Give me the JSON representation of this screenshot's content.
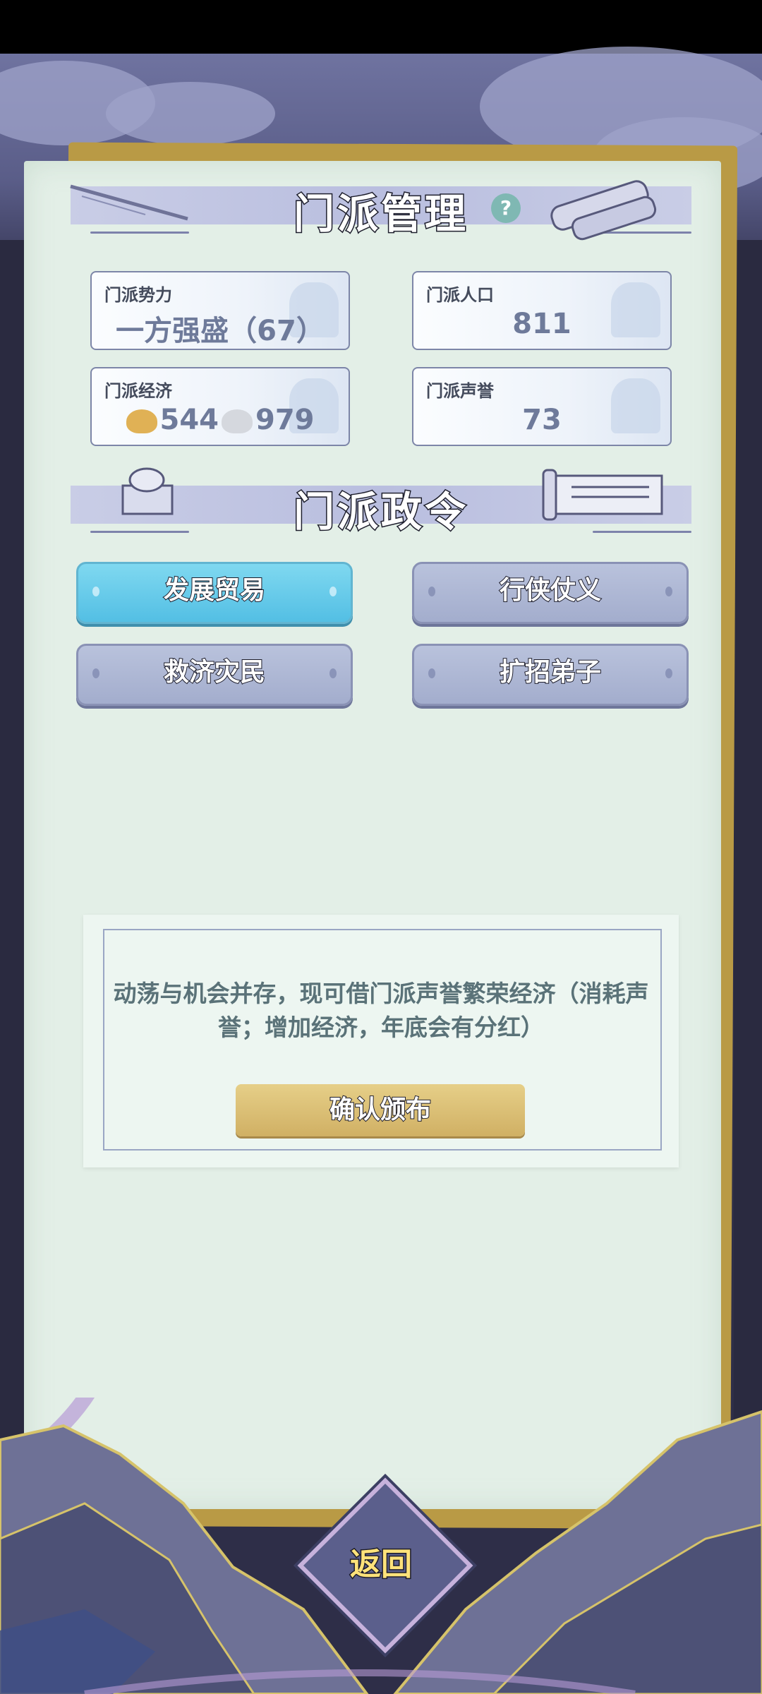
{
  "header": {
    "title": "门派管理"
  },
  "stats": {
    "power": {
      "label": "门派势力",
      "value": "一方强盛（67）"
    },
    "population": {
      "label": "门派人口",
      "value": "811"
    },
    "economy": {
      "label": "门派经济",
      "gold": "544",
      "silver": "979"
    },
    "reputation": {
      "label": "门派声誉",
      "value": "73"
    }
  },
  "decrees": {
    "title": "门派政令",
    "buttons": [
      {
        "label": "发展贸易"
      },
      {
        "label": "行侠仗义"
      },
      {
        "label": "救济灾民"
      },
      {
        "label": "扩招弟子"
      }
    ]
  },
  "notice": {
    "text": "动荡与机会并存，现可借门派声誉繁荣经济（消耗声誉；增加经济，年底会有分红）",
    "confirm_label": "确认颁布"
  },
  "footer": {
    "return_label": "返回"
  },
  "colors": {
    "active_tab": "#5ec7ea",
    "gold": "#d8b96d",
    "paper": "#e3efe7"
  }
}
